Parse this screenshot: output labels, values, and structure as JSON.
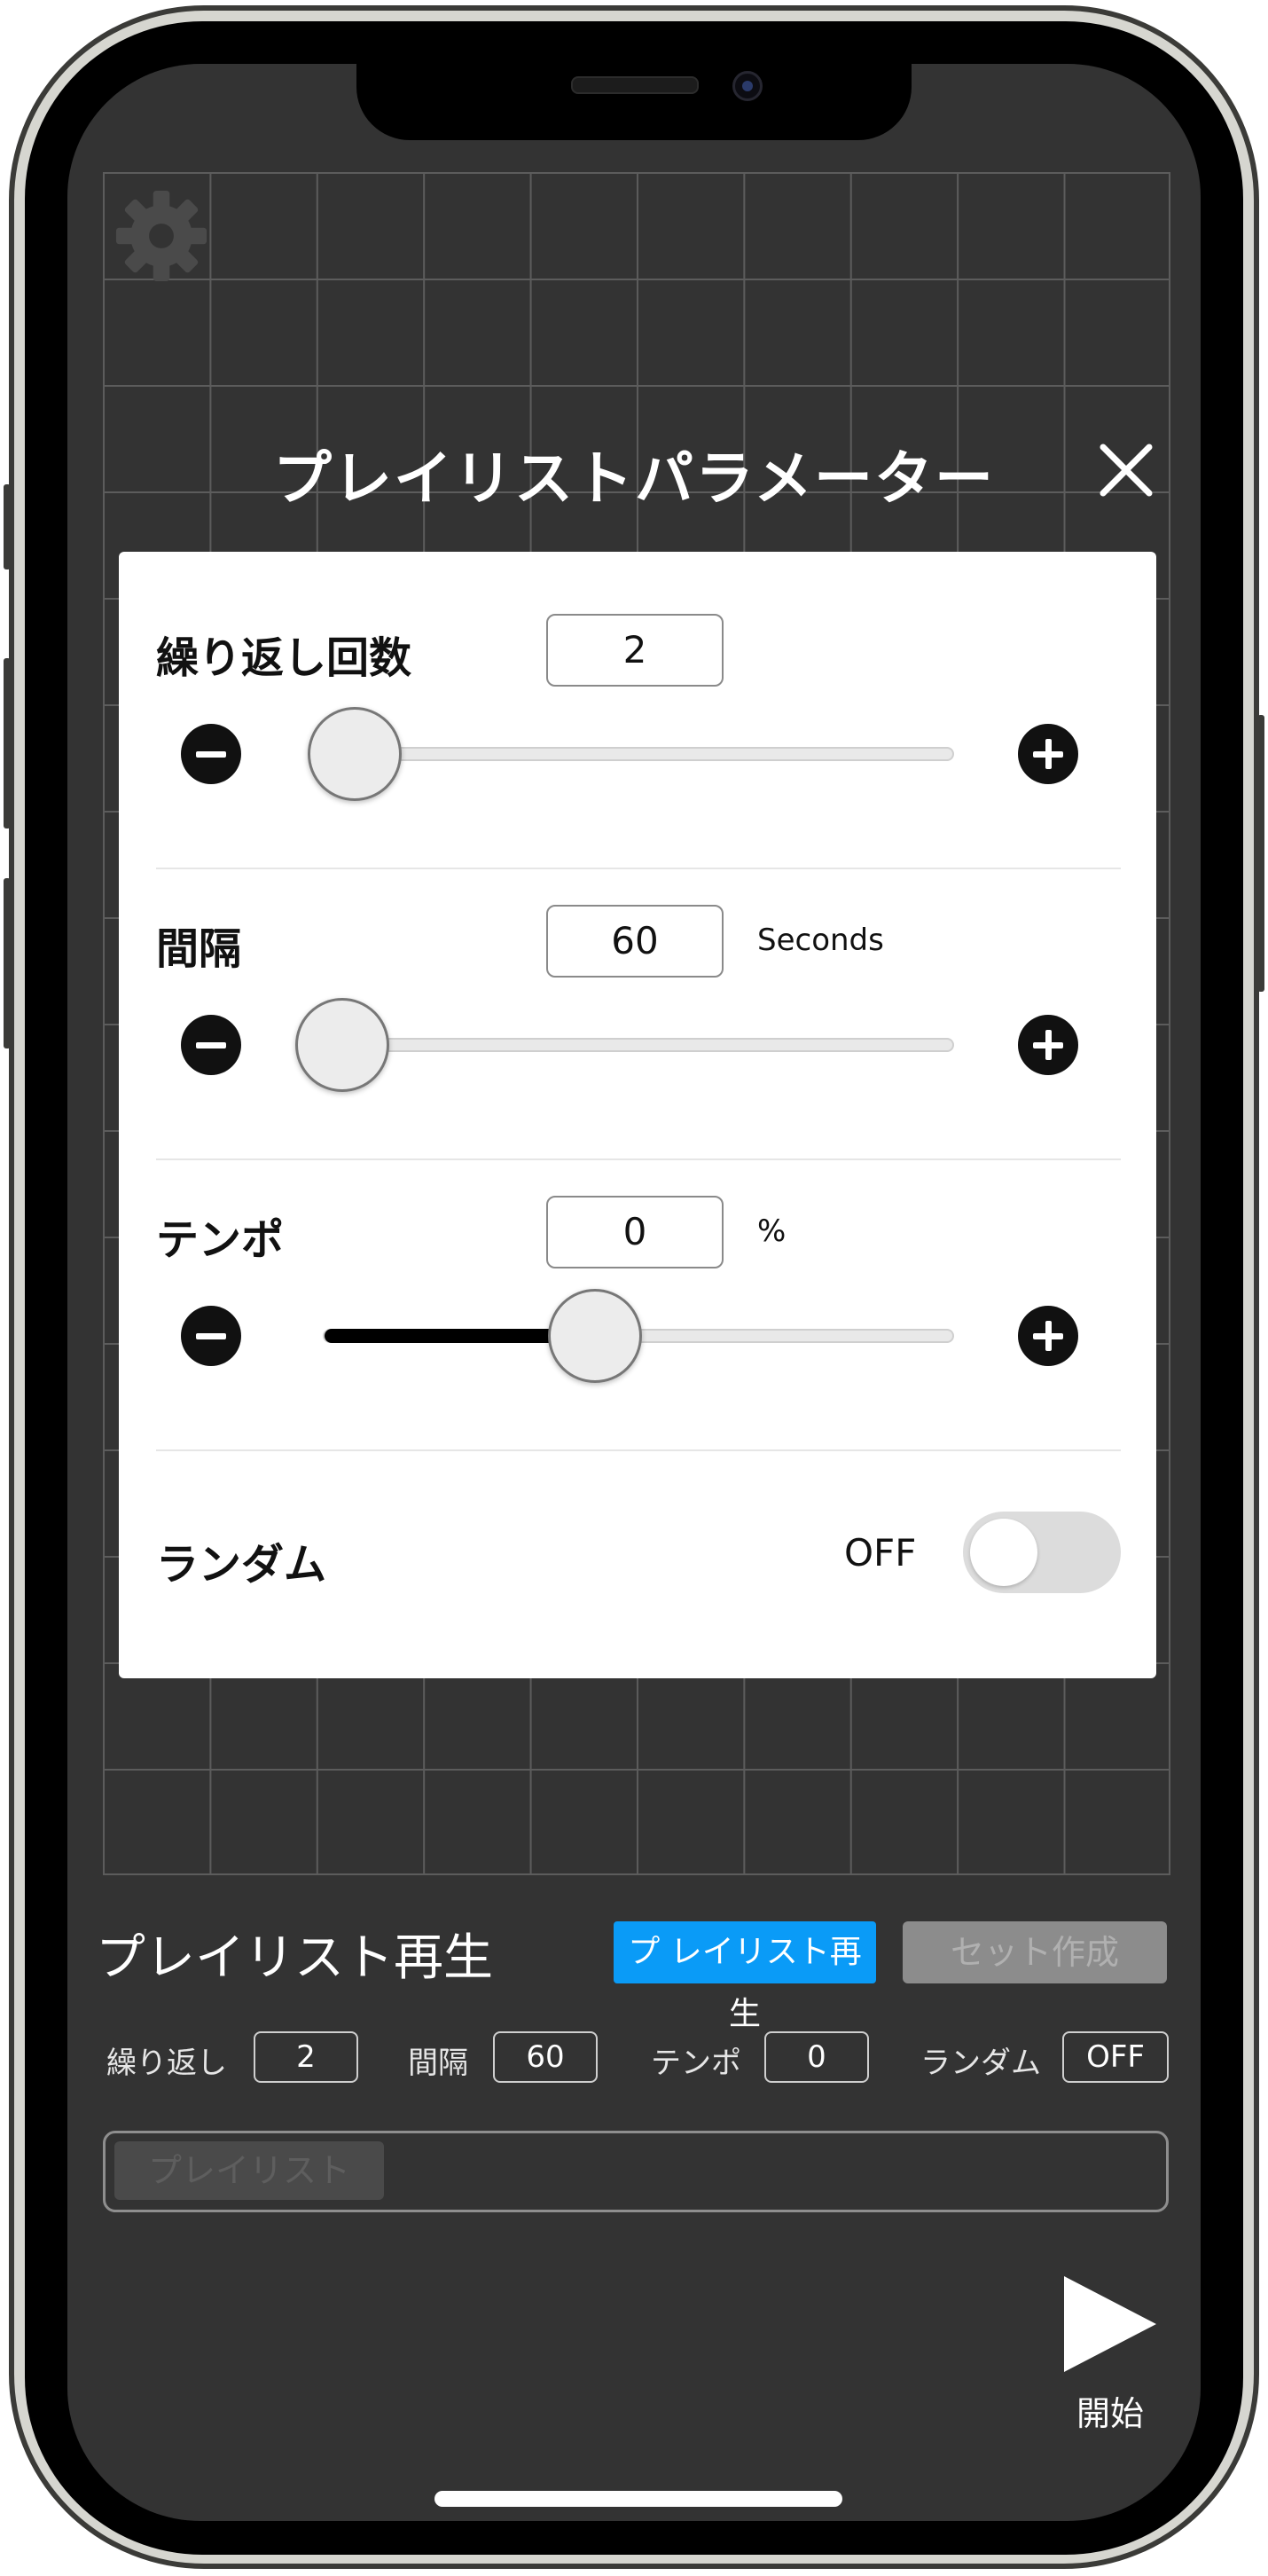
{
  "modal": {
    "title": "プレイリストパラメーター"
  },
  "params": {
    "repeat": {
      "label": "繰り返し回数",
      "value": "2",
      "slider_fraction": 0.02
    },
    "interval": {
      "label": "間隔",
      "value": "60",
      "unit": "Seconds",
      "slider_fraction": 0.0
    },
    "tempo": {
      "label": "テンポ",
      "value": "0",
      "unit": "%",
      "slider_fraction": 0.4
    },
    "random": {
      "label": "ランダム",
      "state": "OFF"
    }
  },
  "playback": {
    "heading": "プレイリスト再生",
    "play_button": "プ レイリスト再生",
    "create_set_button": "セット作成",
    "summary": {
      "repeat_label": "繰り返し",
      "repeat_value": "2",
      "interval_label": "間隔",
      "interval_value": "60",
      "tempo_label": "テンポ",
      "tempo_value": "0",
      "random_label": "ランダム",
      "random_value": "OFF"
    },
    "playlist_chip": "プレイリスト",
    "start_label": "開始"
  },
  "colors": {
    "screen_bg": "#333333",
    "primary_button": "#0a9bf7",
    "panel_bg": "#ffffff"
  },
  "icons": [
    "gear-icon",
    "close-icon",
    "minus-icon",
    "plus-icon",
    "play-icon"
  ]
}
